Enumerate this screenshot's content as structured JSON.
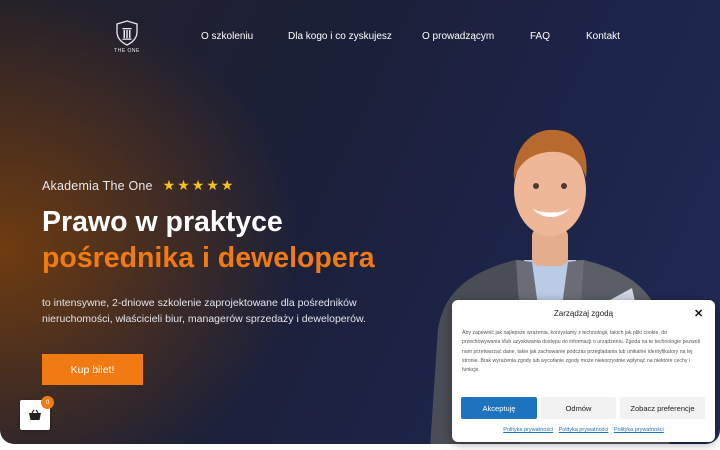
{
  "nav": {
    "logo_text": "THE ONE",
    "items": [
      {
        "label": "O szkoleniu"
      },
      {
        "label": "Dla kogo i co zyskujesz"
      },
      {
        "label": "O prowadzącym"
      },
      {
        "label": "FAQ"
      },
      {
        "label": "Kontakt"
      }
    ]
  },
  "hero": {
    "brand": "Akademia The One",
    "stars": "★★★★★",
    "rating": 5,
    "title_line1": "Prawo w praktyce",
    "title_line2": "pośrednika i dewelopera",
    "description": "to intensywne, 2-dniowe szkolenie zaprojektowane dla pośredników nieruchomości, właścicieli biur, managerów sprzedaży i deweloperów.",
    "cta": "Kup bilet!"
  },
  "cart": {
    "count": "0",
    "icon": "basket-icon"
  },
  "consent": {
    "title": "Zarządzaj zgodą",
    "text": "Aby zapewnić jak najlepsze wrażenia, korzystamy z technologii, takich jak pliki cookie, do przechowywania i/lub uzyskiwania dostępu do informacji o urządzeniu. Zgoda na te technologie pozwoli nam przetwarzać dane, takie jak zachowanie podczas przeglądania lub unikalne identyfikatory na tej stronie. Brak wyrażenia zgody lub wycofanie zgody może niekorzystnie wpłynąć na niektóre cechy i funkcje.",
    "accept": "Akceptuję",
    "deny": "Odmów",
    "preferences": "Zobacz preferencje",
    "links": [
      "Polityka prywatności",
      "Polityka prywatności",
      "Polityka prywatności"
    ]
  },
  "colors": {
    "accent": "#f27a12",
    "navy": "#1c2449",
    "stars": "#f7c21a",
    "button_blue": "#1e73be"
  }
}
